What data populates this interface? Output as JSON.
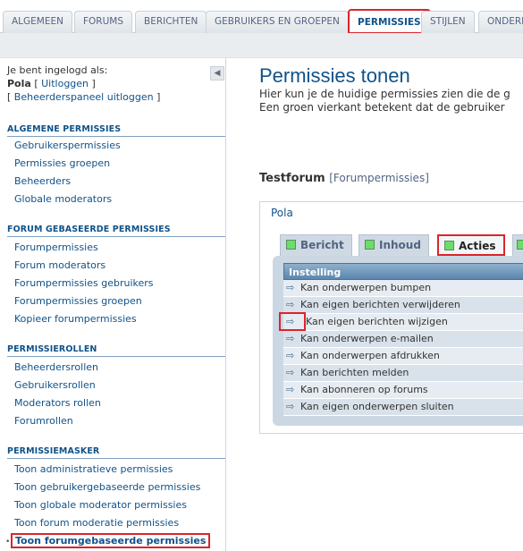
{
  "tabs": [
    {
      "label": "ALGEMEEN"
    },
    {
      "label": "FORUMS"
    },
    {
      "label": "BERICHTEN"
    },
    {
      "label": "GEBRUIKERS EN GROEPEN"
    },
    {
      "label": "PERMISSIES"
    },
    {
      "label": "STIJLEN"
    },
    {
      "label": "ONDERH"
    }
  ],
  "active_tab": "PERMISSIES",
  "sidebar": {
    "login_label": "Je bent ingelogd als:",
    "username": "Pola",
    "logout_open": "[",
    "logout_link": "Uitloggen",
    "logout_close": "]",
    "admin_logout_open": "[",
    "admin_logout_link": "Beheerderspaneel uitloggen",
    "admin_logout_close": "]",
    "collapse_glyph": "◀",
    "sections": [
      {
        "heading": "ALGEMENE PERMISSIES",
        "items": [
          "Gebruikerspermissies",
          "Permissies groepen",
          "Beheerders",
          "Globale moderators"
        ]
      },
      {
        "heading": "FORUM GEBASEERDE PERMISSIES",
        "items": [
          "Forumpermissies",
          "Forum moderators",
          "Forumpermissies gebruikers",
          "Forumpermissies groepen",
          "Kopieer forumpermissies"
        ]
      },
      {
        "heading": "PERMISSIEROLLEN",
        "items": [
          "Beheerdersrollen",
          "Gebruikersrollen",
          "Moderators rollen",
          "Forumrollen"
        ]
      },
      {
        "heading": "PERMISSIEMASKER",
        "items": [
          "Toon administratieve permissies",
          "Toon gebruikergebaseerde permissies",
          "Toon globale moderator permissies",
          "Toon forum moderatie permissies",
          "Toon forumgebaseerde permissies"
        ]
      }
    ]
  },
  "main": {
    "title": "Permissies tonen",
    "desc_line1": "Hier kun je de huidige permissies zien die de g",
    "desc_line2": "Een groen vierkant betekent dat de gebruiker",
    "forum_title": "Testforum",
    "forum_sub": "[Forumpermissies]",
    "panel_legend": "Pola",
    "panel_tabs": [
      {
        "label": "Bericht"
      },
      {
        "label": "Inhoud"
      },
      {
        "label": "Acties"
      }
    ],
    "active_panel_tab": "Acties",
    "table_header": "Instelling",
    "rows": [
      "Kan onderwerpen bumpen",
      "Kan eigen berichten verwijderen",
      "Kan eigen berichten wijzigen",
      "Kan onderwerpen e-mailen",
      "Kan onderwerpen afdrukken",
      "Kan berichten melden",
      "Kan abonneren op forums",
      "Kan eigen onderwerpen sluiten"
    ],
    "row_icon_glyph": "⇨"
  },
  "colors": {
    "accent": "#105289",
    "highlight": "#d9252b",
    "granted": "#6cdc6c"
  }
}
